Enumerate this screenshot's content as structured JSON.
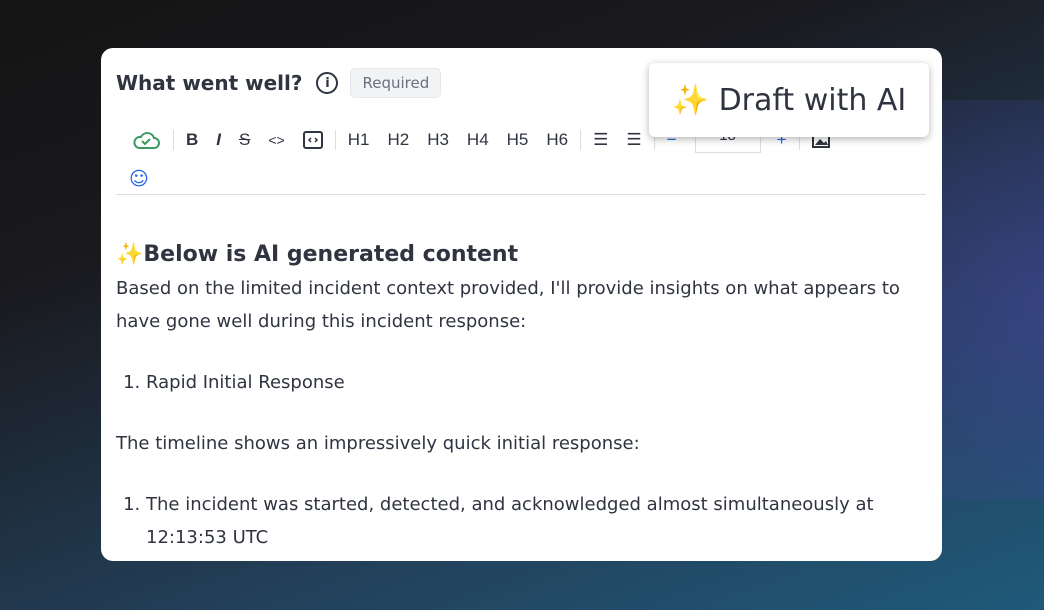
{
  "field": {
    "title": "What went well?",
    "badge": "Required"
  },
  "toolbar": {
    "items": [
      "B",
      "I",
      "S",
      "<>",
      "H1",
      "H2",
      "H3",
      "H4",
      "H5",
      "H6"
    ],
    "font_size": "18",
    "minus": "−",
    "plus": "+"
  },
  "popup": {
    "label": "✨ Draft with AI"
  },
  "content": {
    "heading": "✨Below is AI generated content",
    "intro": "Based on the limited incident context provided, I'll provide insights on what appears to have gone well during this incident response:",
    "list1": [
      "Rapid Initial Response"
    ],
    "para2": "The timeline shows an impressively quick initial response:",
    "list2": [
      "The incident was started, detected, and acknowledged almost simultaneously at 12:13:53 UTC"
    ]
  },
  "colors": {
    "saved": "#3a9a62",
    "accent": "#2563eb"
  }
}
